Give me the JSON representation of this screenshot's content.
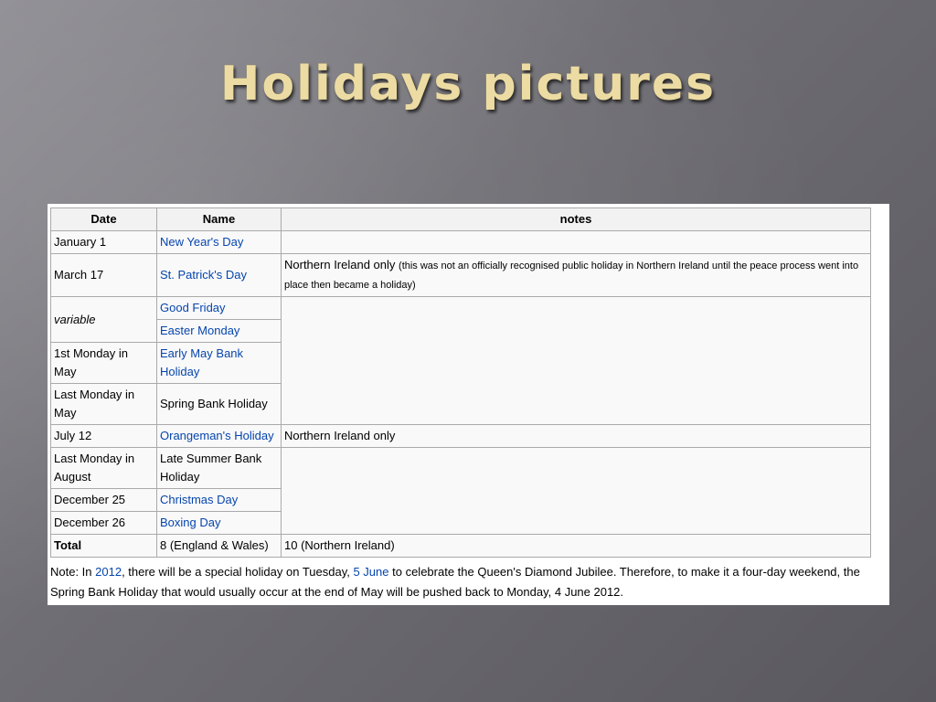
{
  "slide": {
    "title": "Holidays pictures"
  },
  "table": {
    "headers": [
      "Date",
      "Name",
      "notes"
    ],
    "rows": {
      "r1": {
        "date": "January 1",
        "name": "New Year's Day"
      },
      "r2": {
        "date": "March 17",
        "name": "St. Patrick's Day",
        "note_main": "Northern Ireland only",
        "note_small": "(this was not an officially recognised public holiday in Northern Ireland until the peace process went into place then became a holiday)"
      },
      "r3": {
        "date": "variable",
        "name": "Good Friday"
      },
      "r4": {
        "name": "Easter Monday"
      },
      "r5": {
        "date": "1st Monday in May",
        "name": "Early May Bank Holiday"
      },
      "r6": {
        "date": "Last Monday in May",
        "name": "Spring Bank Holiday"
      },
      "r7": {
        "date": "July 12",
        "name": "Orangeman's Holiday",
        "note": "Northern Ireland only"
      },
      "r8": {
        "date": "Last Monday in August",
        "name": "Late Summer Bank Holiday"
      },
      "r9": {
        "date": "December 25",
        "name": "Christmas Day"
      },
      "r10": {
        "date": "December 26",
        "name": "Boxing Day"
      },
      "total": {
        "date": "Total",
        "name": "8 (England & Wales)",
        "note": "10 (Northern Ireland)"
      }
    }
  },
  "note": {
    "t1": "Note: In ",
    "link_year": "2012",
    "t2": ", there will be a special holiday on Tuesday, ",
    "link_date": "5 June",
    "t3": " to celebrate the Queen's Diamond Jubilee. Therefore, to make it a four-day weekend, the Spring Bank Holiday that would usually occur at the end of May will be pushed back to Monday, 4 June 2012."
  },
  "colors": {
    "title": "#ecdca4",
    "link": "#0645ad",
    "header_bg": "#f2f2f2",
    "cell_bg": "#f9f9f9",
    "border": "#aaaaaa"
  }
}
